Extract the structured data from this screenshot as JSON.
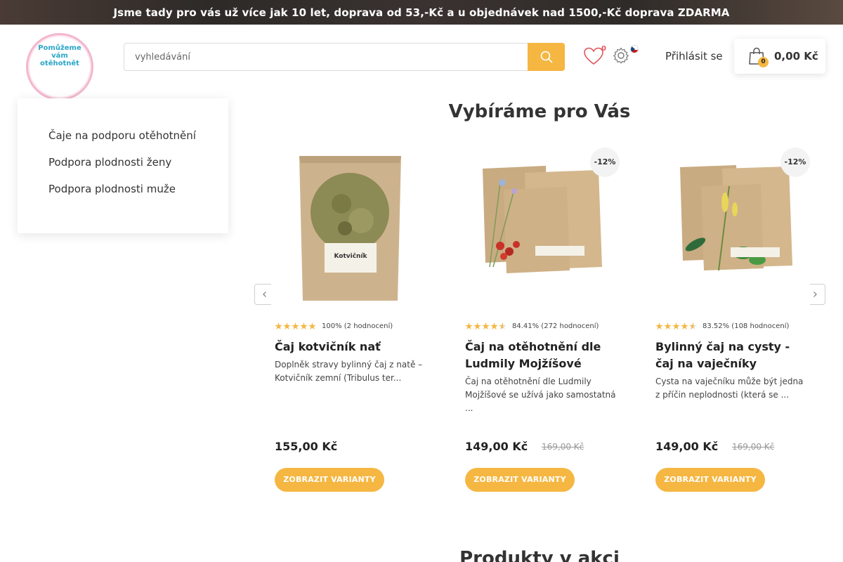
{
  "banner": {
    "text": "Jsme tady pro vás už více jak 10 let, doprava od 53,-Kč a u objednávek nad 1500,-Kč doprava ZDARMA"
  },
  "logo": {
    "text": "Pomůžeme vám otěhotnět"
  },
  "search": {
    "placeholder": "vyhledávání",
    "value": ""
  },
  "header": {
    "wishlist_count": "0",
    "login_label": "Přihlásit se",
    "cart_count": "0",
    "cart_total": "0,00 Kč"
  },
  "sidemenu": {
    "items": [
      {
        "label": "Čaje na podporu otěhotnění"
      },
      {
        "label": "Podpora plodnosti ženy"
      },
      {
        "label": "Podpora plodnosti muže"
      }
    ]
  },
  "sections": {
    "featured_title": "Vybíráme pro Vás",
    "sale_title": "Produkty v akci"
  },
  "products": [
    {
      "rating_stars": 5,
      "rating_text": "100% (2 hodnocení)",
      "name": "Čaj kotvičník nať",
      "description": "Doplněk stravy bylinný čaj z natě – Kotvičník zemní (Tribulus ter...",
      "price": "155,00 Kč",
      "old_price": "",
      "discount": "",
      "button": "ZOBRAZIT VARIANTY"
    },
    {
      "rating_stars": 4.5,
      "rating_text": "84.41% (272 hodnocení)",
      "name": "Čaj na otěhotnění dle Ludmily Mojžíšové",
      "description": "Čaj na otěhotnění dle Ludmily Mojžíšové se užívá jako samostatná ...",
      "price": "149,00 Kč",
      "old_price": "169,00 Kč",
      "discount": "-12%",
      "button": "ZOBRAZIT VARIANTY"
    },
    {
      "rating_stars": 4.5,
      "rating_text": "83.52% (108 hodnocení)",
      "name": "Bylinný čaj na cysty - čaj na vaječníky",
      "description": "Cysta na vaječníku může být jedna z příčin neplodnosti (která se ...",
      "price": "149,00 Kč",
      "old_price": "169,00 Kč",
      "discount": "-12%",
      "button": "ZOBRAZIT VARIANTY"
    }
  ],
  "colors": {
    "accent": "#f5b742",
    "logo_pink": "#f2b7cd",
    "logo_text": "#2aa6c7",
    "wishlist": "#e0565b"
  },
  "icons": {
    "search": "search-icon",
    "wishlist": "heart-icon",
    "settings": "gear-icon",
    "cart": "shopping-bag-icon",
    "prev": "chevron-left-icon",
    "next": "chevron-right-icon",
    "star": "star-icon"
  }
}
